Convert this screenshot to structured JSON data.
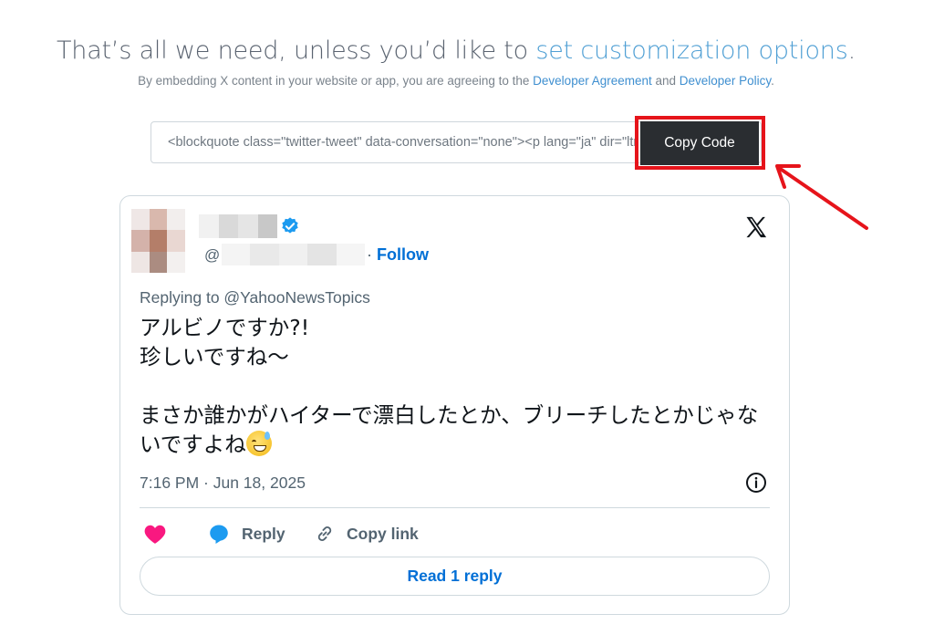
{
  "header": {
    "heading_prefix": "That’s all we need, unless you’d like to ",
    "heading_link": "set customization options",
    "heading_suffix": ".",
    "sub_prefix": "By embedding X content in your website or app, you are agreeing to the ",
    "sub_link1": "Developer Agreement",
    "sub_mid": " and ",
    "sub_link2": "Developer Policy",
    "sub_suffix": "."
  },
  "embed": {
    "code_snippet": "<blockquote class=\"twitter-tweet\" data-conversation=\"none\"><p lang=\"ja\" dir=\"ltr\">",
    "copy_button_label": "Copy Code",
    "highlight_color": "#e6141b"
  },
  "tweet": {
    "handle_at": "@",
    "follow_sep": "·",
    "follow_label": "Follow",
    "replying_to": "Replying to @YahooNewsTopics",
    "text_lines": "アルビノですか?!\n珍しいですね〜\n\nまさか誰かがハイターで漂白したとか、ブリーチしたとかじゃないですよね",
    "timestamp": "7:16 PM · Jun 18, 2025",
    "reply_label": "Reply",
    "copy_link_label": "Copy link",
    "read_reply_label": "Read 1 reply",
    "icons": [
      "verified-badge-icon",
      "x-logo-icon",
      "info-icon",
      "heart-icon",
      "reply-bubble-icon",
      "link-icon",
      "grinning-sweat-emoji"
    ],
    "colors": {
      "like": "#f91880",
      "reply": "#1d9bf0",
      "link": "#006fd6",
      "verified": "#1d9bf0"
    }
  }
}
